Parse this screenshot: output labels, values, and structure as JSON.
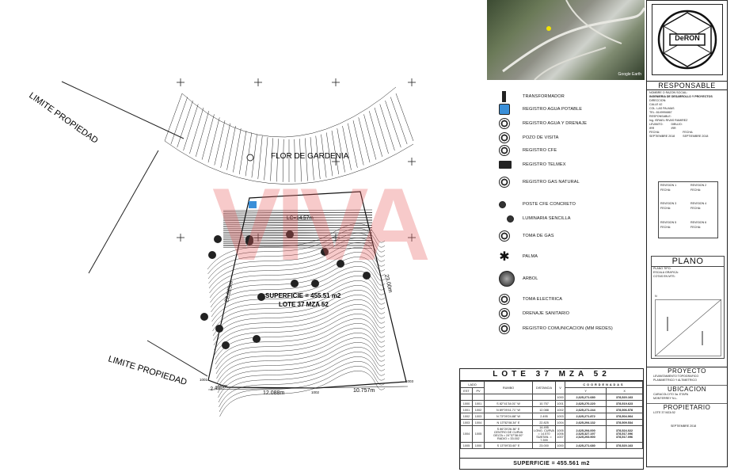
{
  "plan": {
    "limite_top": "LIMITE PROPIEDAD",
    "limite_bottom": "LIMITE PROPIEDAD",
    "street": "FLOR DE GARDENIA",
    "lc": "LC=14.57m",
    "superficie": "SUPERFICIE = 455.51 m2",
    "lote": "LOTE 37 MZA 52",
    "dim_left": "22.825m",
    "dim_right": "23.00m",
    "dim_b1": "2.495m",
    "dim_b2": "12.088m",
    "dim_b3": "10.757m",
    "v1": "1001",
    "v2": "1002",
    "v3": "1003",
    "v4": "1004",
    "v5": "1005",
    "v6": "1006"
  },
  "photo": {
    "credit": "Google Earth"
  },
  "legend": {
    "items": [
      {
        "label": "TRANSFORMADOR",
        "icon": "transformer-icon"
      },
      {
        "label": "REGISTRO AGUA POTABLE",
        "icon": "water-register-icon"
      },
      {
        "label": "REGISTRO AGUA Y DRENAJE",
        "icon": "water-drain-register-icon"
      },
      {
        "label": "POZO DE VISITA",
        "icon": "manhole-icon"
      },
      {
        "label": "REGISTRO CFE",
        "icon": "cfe-register-icon"
      },
      {
        "label": "REGISTRO TELMEX",
        "icon": "telmex-register-icon"
      },
      {
        "label": "REGISTRO GAS NATURAL",
        "icon": "gas-register-icon"
      },
      {
        "label": "POSTE CFE CONCRETO",
        "icon": "pole-icon"
      },
      {
        "label": "LUMINARIA SENCILLA",
        "icon": "streetlight-icon"
      },
      {
        "label": "TOMA DE GAS",
        "icon": "gas-outlet-icon"
      },
      {
        "label": "PALMA",
        "icon": "palm-icon"
      },
      {
        "label": "ARBOL",
        "icon": "tree-icon"
      },
      {
        "label": "TOMA ELECTRICA",
        "icon": "electric-outlet-icon"
      },
      {
        "label": "DRENAJE SANITARIO",
        "icon": "sanitary-drain-icon"
      },
      {
        "label": "REGISTRO COMUNICACION (MM REDES)",
        "icon": "comm-register-icon"
      }
    ]
  },
  "titleblock": {
    "logo": "DeRON",
    "responsable": "RESPONSABLE",
    "r_line1": "NOMBRE O RAZON SOCIAL:",
    "r_line2": "INGENIERIA DE DESARROLLO Y PROYECTOS",
    "r_line3": "DIRECCION:",
    "r_line4": "CALLE 42",
    "r_line5": "COL. LAS PALMAS",
    "r_line6": "TEL: 8149994867",
    "r_line7": "RESPONSABLE:",
    "r_line8": "Ing. ISRAEL RIVAS RAMIREZ",
    "r_line9": "LEVANTO:",
    "r_line10": "IRR",
    "r_line11": "DIBUJO:",
    "r_line12": "IRR",
    "r_line13": "FECHA:",
    "r_line14": "SEPTIEMBRE 2018",
    "r_line15": "FECHA:",
    "r_line16": "SEPTIEMBRE 2018",
    "rev1": "REVISION 1",
    "rev2": "REVISION 2",
    "rev3": "REVISION 3",
    "rev4": "REVISION 4",
    "rev5": "REVISION 5",
    "rev6": "REVISION 6",
    "fecha": "FECHA:",
    "plano": "PLANO",
    "p1": "PLANO TIPO:",
    "p2": "ESCALA GRAFICA:",
    "p3": "COTAS EN MTS:",
    "norte": "N",
    "proyecto": "PROYECTO",
    "proy1": "LEVANTAMIENTO TOPOGRAFICO",
    "proy2": "PLANIMETRICO Y ALTIMETRICO",
    "ubicacion": "UBICACION",
    "ub1": "CARACOLCITO 3a. ETAPA",
    "ub2": "MONTERREY N.L.",
    "propietario": "PROPIETARIO",
    "prop1": "LOTE 37 MZA 52",
    "fecha_final": "SEPTIEMBRE 2018"
  },
  "table": {
    "title": "LOTE 37 MZA 52",
    "h_lado": "LADO",
    "h_est": "EST",
    "h_pv": "PV",
    "h_rumbo": "RUMBO",
    "h_dist": "DISTANCIA",
    "h_v": "V",
    "h_coord": "COORDENADAS",
    "h_y": "Y",
    "h_x": "X",
    "rows": [
      [
        "",
        "",
        "",
        "",
        "1000",
        "2,625,271.680",
        "378,520.163"
      ],
      [
        "1000",
        "1001",
        "S 82°41'34.01\" W",
        "10.757",
        "1001",
        "2,625,270.220",
        "378,519.623"
      ],
      [
        "1001",
        "1002",
        "N 89°09'41.71\" W",
        "12.088",
        "1002",
        "2,625,271.244",
        "378,506.578"
      ],
      [
        "1002",
        "1003",
        "N 73°09'24.88\" W",
        "2.495",
        "1003",
        "2,625,271.872",
        "378,504.064"
      ],
      [
        "1003",
        "1004",
        "N 13°52'08.34\" E",
        "22.825",
        "1004",
        "2,625,294.132",
        "378,509.534"
      ],
      [
        "1004",
        "1005",
        "S 86°20'26.36\" E\nCENTRO DE CURVA\nDELTA = 24°37'38.00\"\nRADIO = 33.002",
        "14.495\nLONG. CURVA = 14.570\nSUBTAN. = 7.399",
        "1005\n1006\n1007",
        "2,625,294.000\n2,625,327.197\n2,625,293.900",
        "378,524.022\n378,517.096\n378,517.096"
      ],
      [
        "1005",
        "1000",
        "S 13°09'33.60\" E",
        "23.000",
        "1000",
        "2,625,271.680",
        "378,520.163"
      ]
    ],
    "superficie": "SUPERFICIE = 455.561 m2"
  },
  "watermark": "VIVA"
}
